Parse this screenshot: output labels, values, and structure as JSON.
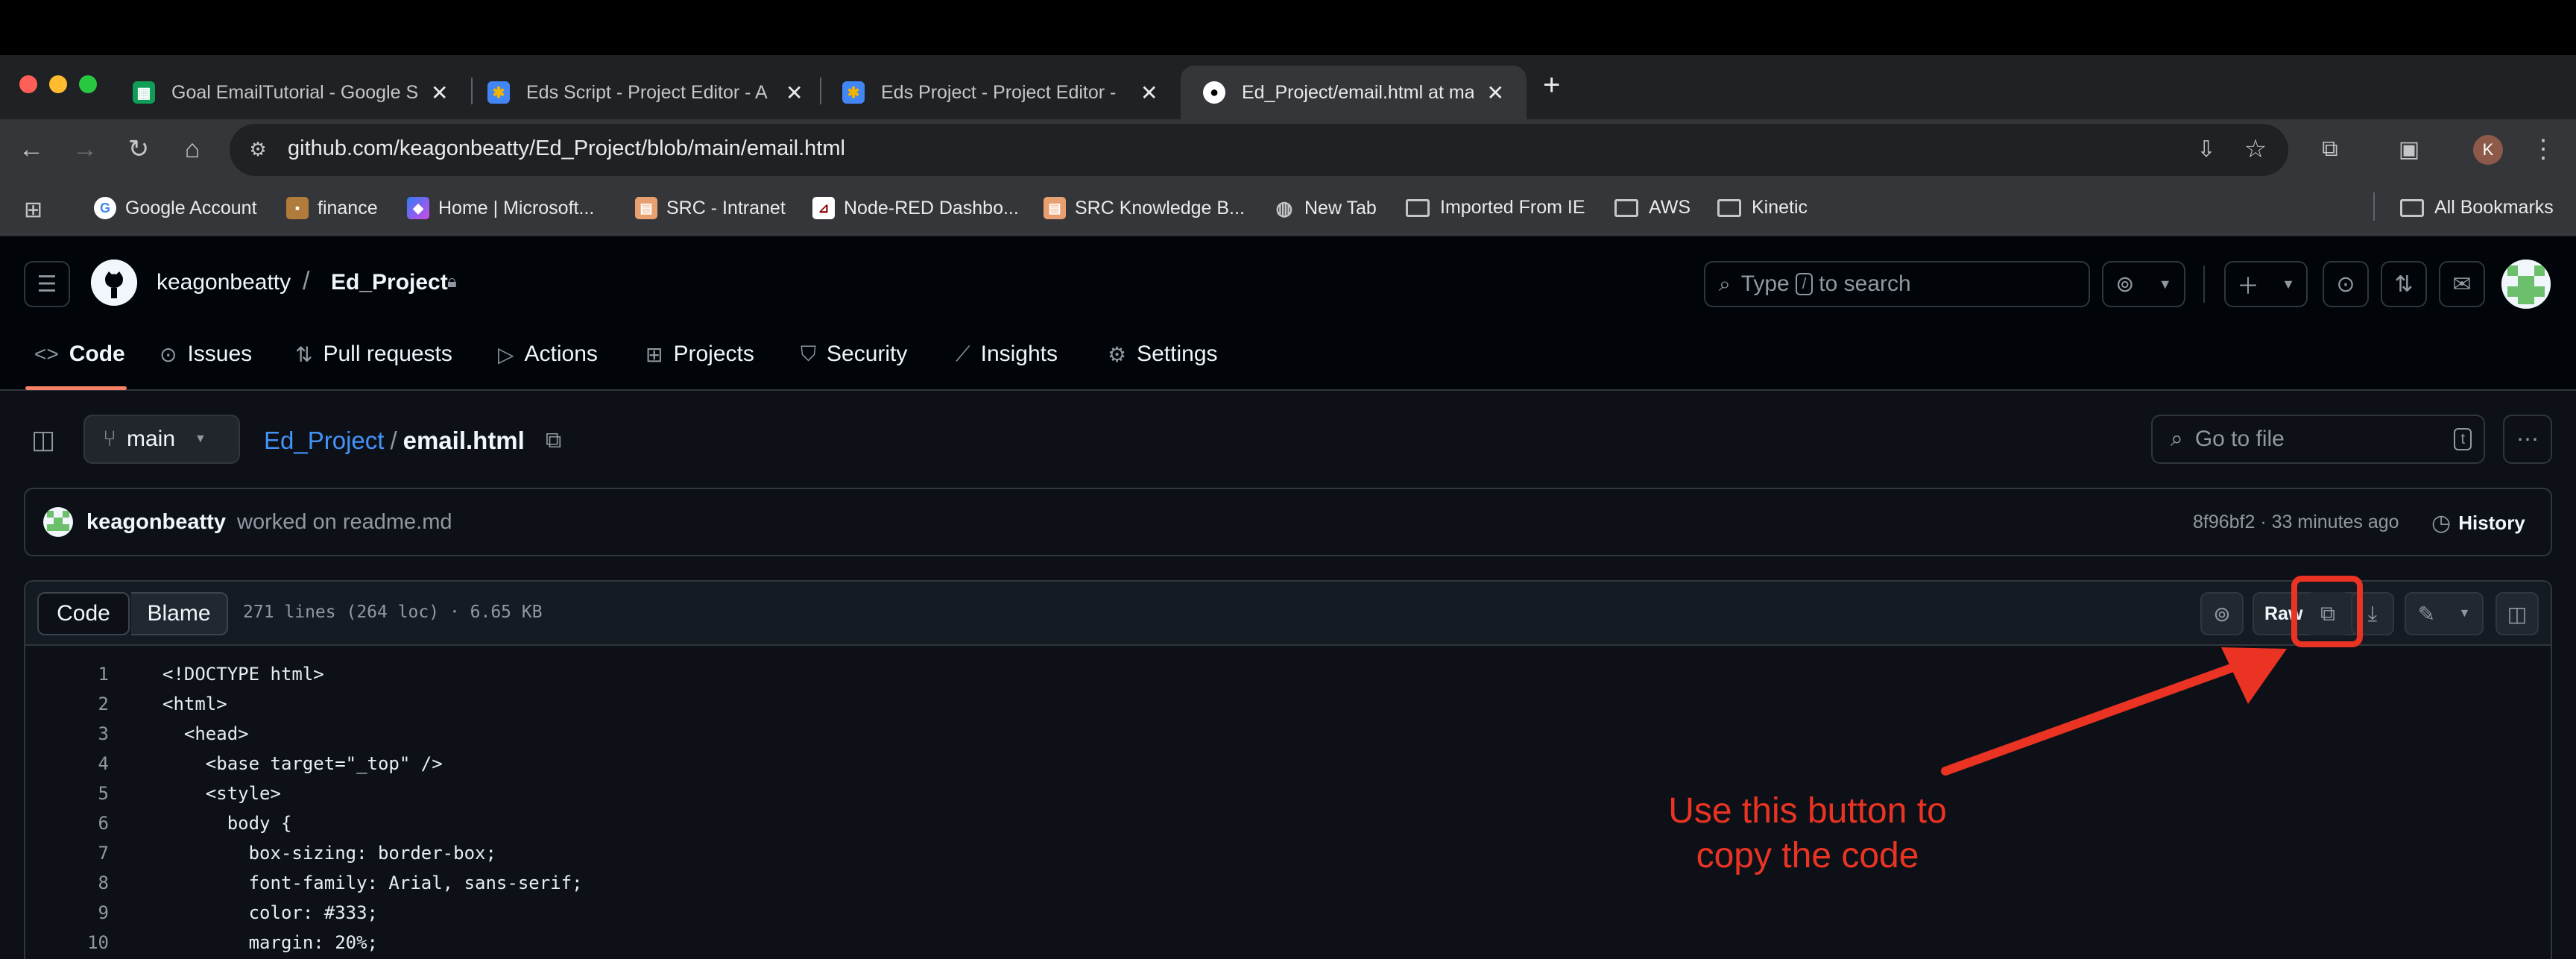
{
  "browser": {
    "tabs": [
      {
        "title": "Goal EmailTutorial - Google S",
        "favicon": "sheets-icon",
        "color": "#0f9d58"
      },
      {
        "title": "Eds Script - Project Editor - A",
        "favicon": "apps-script-icon",
        "color": "#f4b400"
      },
      {
        "title": "Eds Project - Project Editor -",
        "favicon": "apps-script-icon",
        "color": "#f4b400"
      },
      {
        "title": "Ed_Project/email.html at main",
        "favicon": "github-icon",
        "color": "#ffffff"
      }
    ],
    "new_tab": "+",
    "url": "github.com/keagonbeatty/Ed_Project/blob/main/email.html",
    "profile_initial": "K",
    "bookmarks": [
      {
        "label": "Google Account",
        "icon": "google-icon"
      },
      {
        "label": "finance",
        "icon": "box-icon"
      },
      {
        "label": "Home | Microsoft...",
        "icon": "microsoft-icon"
      },
      {
        "label": "SRC - Intranet",
        "icon": "src-icon"
      },
      {
        "label": "Node-RED Dashbo...",
        "icon": "node-red-icon"
      },
      {
        "label": "SRC Knowledge B...",
        "icon": "src-icon"
      },
      {
        "label": "New Tab",
        "icon": "globe-icon"
      },
      {
        "label": "Imported From IE",
        "icon": "folder-icon"
      },
      {
        "label": "AWS",
        "icon": "folder-icon"
      },
      {
        "label": "Kinetic",
        "icon": "folder-icon"
      }
    ],
    "all_bookmarks": "All Bookmarks"
  },
  "github": {
    "owner": "keagonbeatty",
    "separator": "/",
    "repo": "Ed_Project",
    "search_prefix": "Type",
    "search_key": "/",
    "search_suffix": "to search",
    "nav": [
      {
        "label": "Code",
        "icon": "code-icon"
      },
      {
        "label": "Issues",
        "icon": "issue-icon"
      },
      {
        "label": "Pull requests",
        "icon": "pull-request-icon"
      },
      {
        "label": "Actions",
        "icon": "play-icon"
      },
      {
        "label": "Projects",
        "icon": "table-icon"
      },
      {
        "label": "Security",
        "icon": "shield-icon"
      },
      {
        "label": "Insights",
        "icon": "graph-icon"
      },
      {
        "label": "Settings",
        "icon": "gear-icon"
      }
    ]
  },
  "file": {
    "branch": "main",
    "repo_link": "Ed_Project",
    "crumb_sep": "/",
    "filename": "email.html",
    "goto_placeholder": "Go to file",
    "goto_key": "t",
    "commit_author": "keagonbeatty",
    "commit_message": "worked on readme.md",
    "commit_meta": "8f96bf2 · 33 minutes ago",
    "history": "History",
    "tab_code": "Code",
    "tab_blame": "Blame",
    "stats": "271 lines (264 loc) · 6.65 KB",
    "raw": "Raw"
  },
  "code_lines": [
    {
      "n": "1",
      "text": "<!DOCTYPE html>"
    },
    {
      "n": "2",
      "text": "<html>"
    },
    {
      "n": "3",
      "text": "  <head>"
    },
    {
      "n": "4",
      "text": "    <base target=\"_top\" />"
    },
    {
      "n": "5",
      "text": "    <style>"
    },
    {
      "n": "6",
      "text": "      body {"
    },
    {
      "n": "7",
      "text": "        box-sizing: border-box;"
    },
    {
      "n": "8",
      "text": "        font-family: Arial, sans-serif;"
    },
    {
      "n": "9",
      "text": "        color: #333;"
    },
    {
      "n": "10",
      "text": "        margin: 20%;"
    }
  ],
  "annotation": {
    "line1": "Use this button to",
    "line2": "copy the code",
    "color": "#ea3323"
  }
}
